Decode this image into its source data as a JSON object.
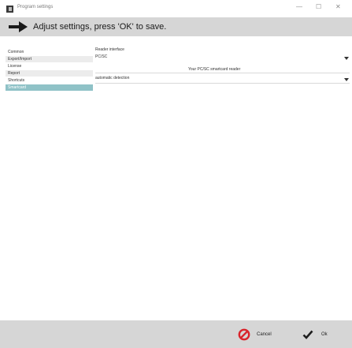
{
  "window": {
    "title": "Program settings",
    "minimize_glyph": "—",
    "maximize_glyph": "☐",
    "close_glyph": "✕",
    "icon": "app-icon"
  },
  "header": {
    "icon": "arrow-right-icon",
    "text": "Adjust settings, press 'OK' to save."
  },
  "sidebar": {
    "items": [
      {
        "label": "Common",
        "selected": false
      },
      {
        "label": "Export/Import",
        "selected": false
      },
      {
        "label": "License",
        "selected": false
      },
      {
        "label": "Report",
        "selected": false
      },
      {
        "label": "Shortcuts",
        "selected": false
      },
      {
        "label": "Smartcard",
        "selected": true
      }
    ]
  },
  "main": {
    "reader_interface_label": "Reader interface",
    "reader_interface_value": "PC/SC",
    "reader_description": "Your PC/SC smartcard reader",
    "reader_detection_value": "automatic detection"
  },
  "footer": {
    "cancel_label": "Cancel",
    "ok_label": "Ok",
    "cancel_color": "#d9242b",
    "ok_color": "#1e1e1e"
  },
  "colors": {
    "header_bg": "#d6d6d6",
    "selected_item_bg": "#8fc2c7",
    "sidebar_stripe_bg": "#ececec"
  }
}
